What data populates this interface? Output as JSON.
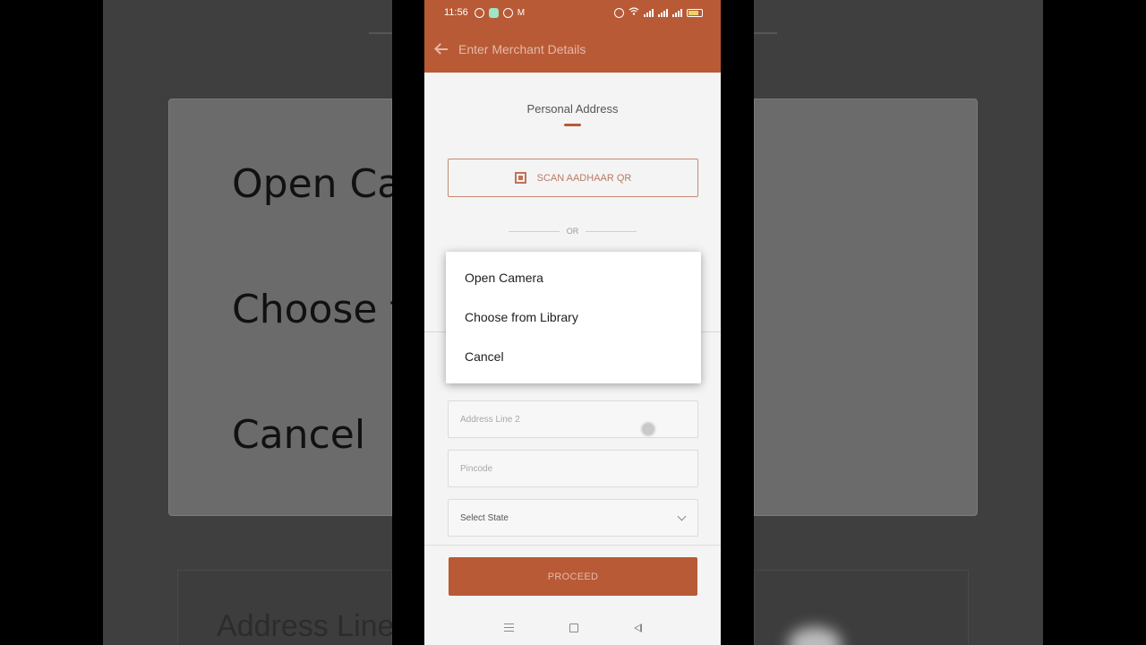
{
  "statusbar": {
    "time": "11:56",
    "left_icons": [
      "at-sign-icon",
      "chat-app-icon",
      "message-icon",
      "gmail-icon"
    ],
    "right_icons": [
      "alarm-icon",
      "wifi-icon",
      "volte-icon",
      "signal-icon",
      "signal-icon",
      "battery-icon"
    ],
    "battery_level": "26"
  },
  "appbar": {
    "back_icon": "arrow-left-icon",
    "title": "Enter Merchant Details"
  },
  "form": {
    "section_tab": "Personal Address",
    "scan_button": "SCAN AADHAAR QR",
    "or_label": "OR",
    "address_line_2_placeholder": "Address Line 2",
    "pincode_placeholder": "Pincode",
    "state_select": "Select State",
    "proceed_button": "PROCEED"
  },
  "dialog": {
    "items": [
      {
        "label": "Open Camera"
      },
      {
        "label": "Choose from Library"
      },
      {
        "label": "Cancel"
      }
    ]
  },
  "navbar": {
    "icons": [
      "menu-icon",
      "home-square-icon",
      "back-triangle-icon"
    ]
  },
  "backdrop": {
    "left_texts": [
      "Open Camera",
      "Choose from Library",
      "Cancel"
    ],
    "bottom_text": "Address Line 2"
  },
  "colors": {
    "accent": "#b85a36",
    "accent_text": "#e6b9a6",
    "dialog_bg": "#ffffff"
  }
}
